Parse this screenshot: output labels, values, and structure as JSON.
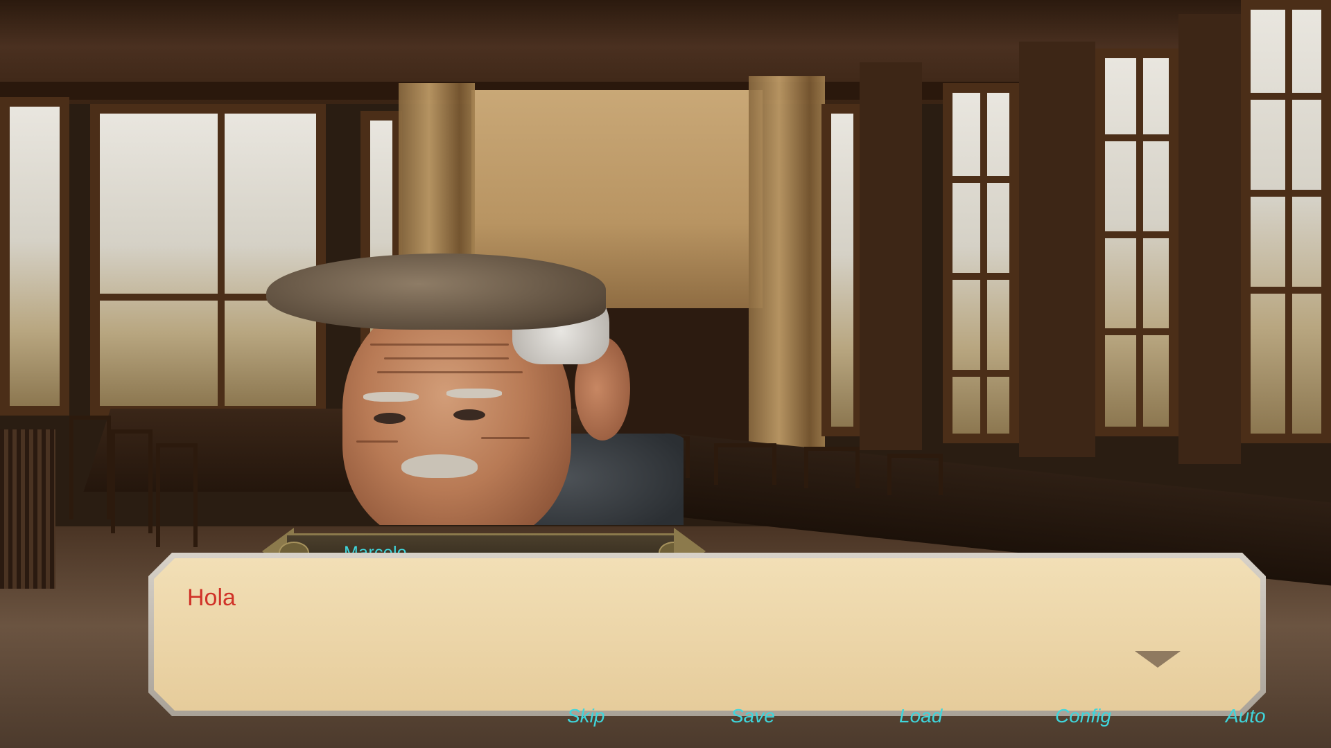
{
  "scene": {
    "background": "old wooden dining hall with large windows and long tables",
    "character_name": "Marcelo"
  },
  "name_plate": {
    "name": "Marcelo"
  },
  "dialogue": {
    "text": "Hola"
  },
  "quick_menu": {
    "skip": "Skip",
    "save": "Save",
    "load": "Load",
    "config": "Config",
    "auto": "Auto"
  },
  "colors": {
    "name_text": "#3fd6dc",
    "dialogue_text": "#d03228",
    "menu_text": "#3fd6dc",
    "dialogue_box": "#f2dfb6"
  }
}
